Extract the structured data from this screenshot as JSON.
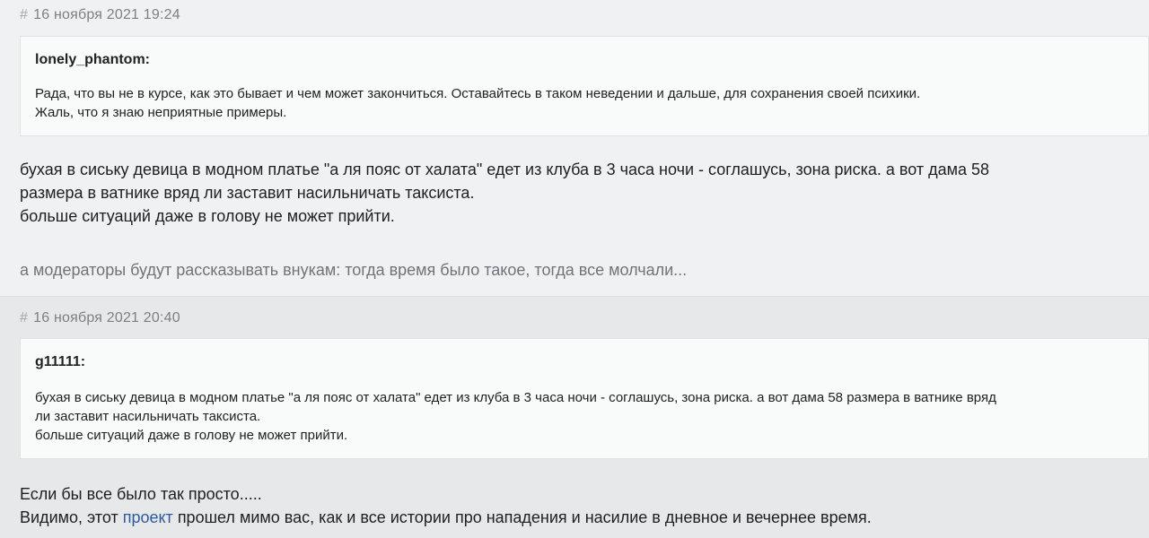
{
  "posts": [
    {
      "hash": "#",
      "date": "16 ноября 2021 19:24",
      "quote": {
        "author": "lonely_phantom:",
        "lines": [
          "Рада, что вы не в курсе, как это бывает и чем может закончиться. Оставайтесь в таком неведении и дальше, для сохранения своей психики.",
          "Жаль, что я знаю неприятные примеры."
        ]
      },
      "body": {
        "lines": [
          "бухая в сиську девица в модном платье \"а ля пояс от халата\" едет из клуба в 3 часа ночи - соглашусь, зона риска. а вот дама 58",
          "размера в ватнике вряд ли заставит насильничать таксиста.",
          "больше ситуаций даже в голову не может прийти."
        ]
      },
      "signature": "а модераторы будут рассказывать внукам: тогда время было такое, тогда все молчали..."
    },
    {
      "hash": "#",
      "date": "16 ноября 2021 20:40",
      "quote": {
        "author": "g11111:",
        "lines": [
          "бухая в сиську девица в модном платье \"а ля пояс от халата\" едет из клуба в 3 часа ночи - соглашусь, зона риска. а вот дама 58 размера в ватнике вряд",
          "ли заставит насильничать таксиста.",
          "больше ситуаций даже в голову не может прийти."
        ]
      },
      "body": {
        "line1": "Если бы все было так просто.....",
        "line2_before": "Видимо, этот ",
        "line2_link": "проект",
        "line2_after": " прошел мимо вас, как и все истории про нападения и насилие в дневное и вечернее время."
      }
    }
  ]
}
